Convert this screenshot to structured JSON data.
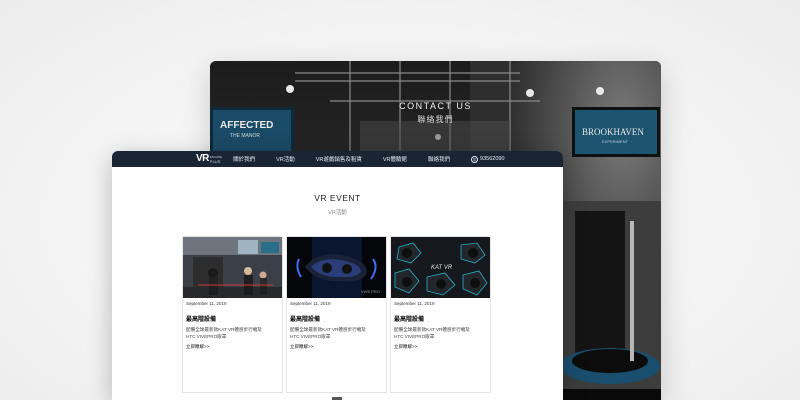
{
  "back_page": {
    "heading_en": "CONTACT US",
    "heading_zh": "聯絡我們",
    "screen_left_text": "AFFECTED",
    "screen_left_sub": "THE MANOR",
    "screen_right_text": "BROOKHAVEN",
    "screen_right_sub": "EXPERIMENT"
  },
  "nav": {
    "logo_main": "VR",
    "logo_sub_top": "ESCAPE",
    "logo_sub_bottom": "PLUS",
    "items": [
      "關於我們",
      "VR活動",
      "VR遊戲銷售及租賃",
      "VR體驗館",
      "聯絡我們"
    ],
    "phone_icon": "whatsapp-icon",
    "phone": "93562090"
  },
  "section": {
    "title": "VR EVENT",
    "subtitle": "VR活動"
  },
  "cards": [
    {
      "date": "September 11, 2019",
      "title": "最高階設備",
      "desc1": "配備全球最新款KAT VR體感步行機及",
      "desc2": "HTC VIVEPRO眼罩",
      "more": "立即瞭解>>"
    },
    {
      "date": "September 11, 2019",
      "title": "最高階設備",
      "desc1": "配備全球最新款KAT VR體感步行機及",
      "desc2": "HTC VIVEPRO眼罩",
      "more": "立即瞭解>>",
      "img_text": "VIVE PRO"
    },
    {
      "date": "September 11, 2019",
      "title": "最高階設備",
      "desc1": "配備全球最新款KAT VR體感步行機及",
      "desc2": "HTC VIVEPRO眼罩",
      "more": "立即瞭解>>",
      "img_text": "KAT VR"
    }
  ],
  "colors": {
    "nav_bg": "#1b2433",
    "page_bg": "#ffffff",
    "accent_teal": "#2bb0c8"
  }
}
